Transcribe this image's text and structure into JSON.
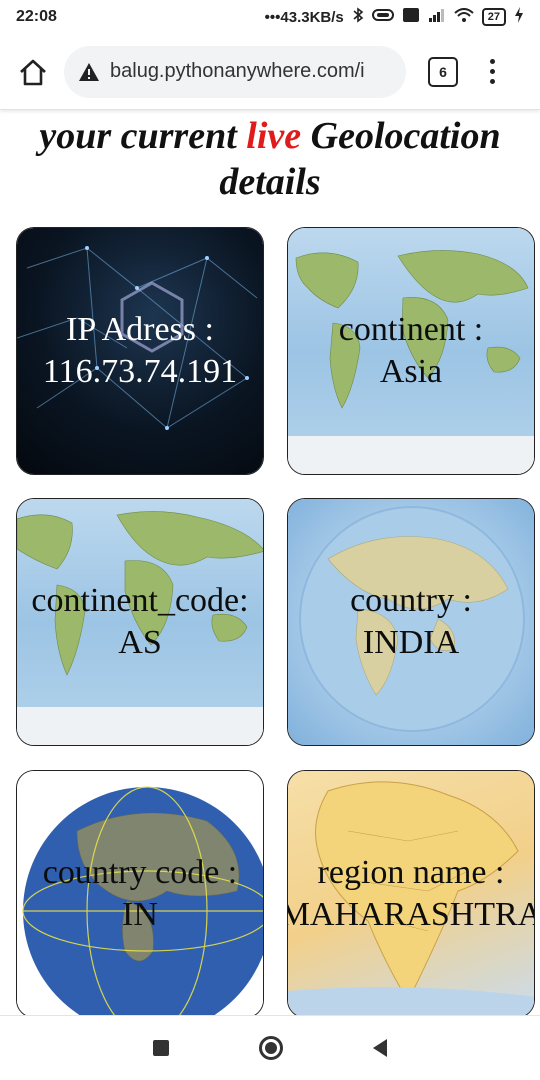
{
  "status_bar": {
    "time": "22:08",
    "network_speed": "•••43.3KB/s",
    "battery": "27"
  },
  "browser": {
    "url": "balug.pythonanywhere.com/i",
    "tab_count": "6",
    "icons": [
      "home-icon",
      "warning-icon",
      "tabs-icon",
      "menu-icon"
    ]
  },
  "page": {
    "heading_pre": "your current ",
    "heading_live": "live",
    "heading_post": " Geolocation details",
    "live_color": "#e01b1b"
  },
  "cards": [
    {
      "line1": "IP Adress :",
      "line2": "116.73.74.191"
    },
    {
      "line1": "continent :",
      "line2": "Asia"
    },
    {
      "line1": "continent_code:",
      "line2": "AS"
    },
    {
      "line1": "country :",
      "line2": "INDIA"
    },
    {
      "line1": "country code :",
      "line2": "IN"
    },
    {
      "line1": "region name :",
      "line2": "MAHARASHTRA"
    }
  ],
  "nav_bar": {
    "icons": [
      "recent-apps-icon",
      "home-circle-icon",
      "back-icon"
    ]
  }
}
